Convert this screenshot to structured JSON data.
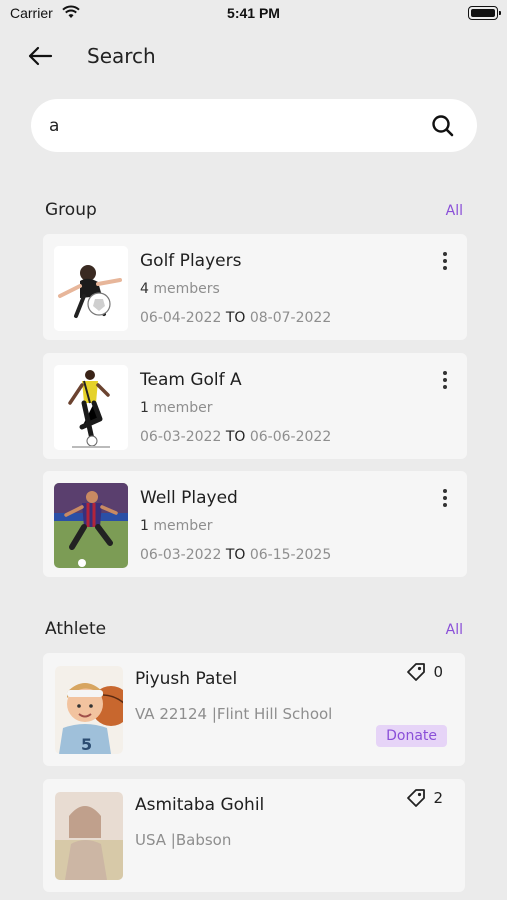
{
  "status_bar": {
    "carrier": "Carrier",
    "time": "5:41 PM"
  },
  "header": {
    "title": "Search"
  },
  "search": {
    "value": "a",
    "placeholder": ""
  },
  "groups": {
    "heading": "Group",
    "all_label": "All",
    "items": [
      {
        "name": "Golf Players",
        "member_count": "4",
        "member_word": "members",
        "start": "06-04-2022",
        "to": "TO",
        "end": "08-07-2022"
      },
      {
        "name": "Team Golf A",
        "member_count": "1",
        "member_word": "member",
        "start": "06-03-2022",
        "to": "TO",
        "end": "06-06-2022"
      },
      {
        "name": "Well Played",
        "member_count": "1",
        "member_word": "member",
        "start": "06-03-2022",
        "to": "TO",
        "end": "06-15-2025"
      }
    ]
  },
  "athletes": {
    "heading": "Athlete",
    "all_label": "All",
    "items": [
      {
        "name": "Piyush Patel",
        "location": "VA 22124 |Flint Hill School",
        "tag_count": "0",
        "donate_label": "Donate"
      },
      {
        "name": "Asmitaba Gohil",
        "location": "USA |Babson",
        "tag_count": "2"
      }
    ]
  },
  "colors": {
    "accent": "#8a4fd8",
    "donate_bg": "#e6d4f7",
    "background": "#ebebeb",
    "card": "#f6f6f6"
  }
}
